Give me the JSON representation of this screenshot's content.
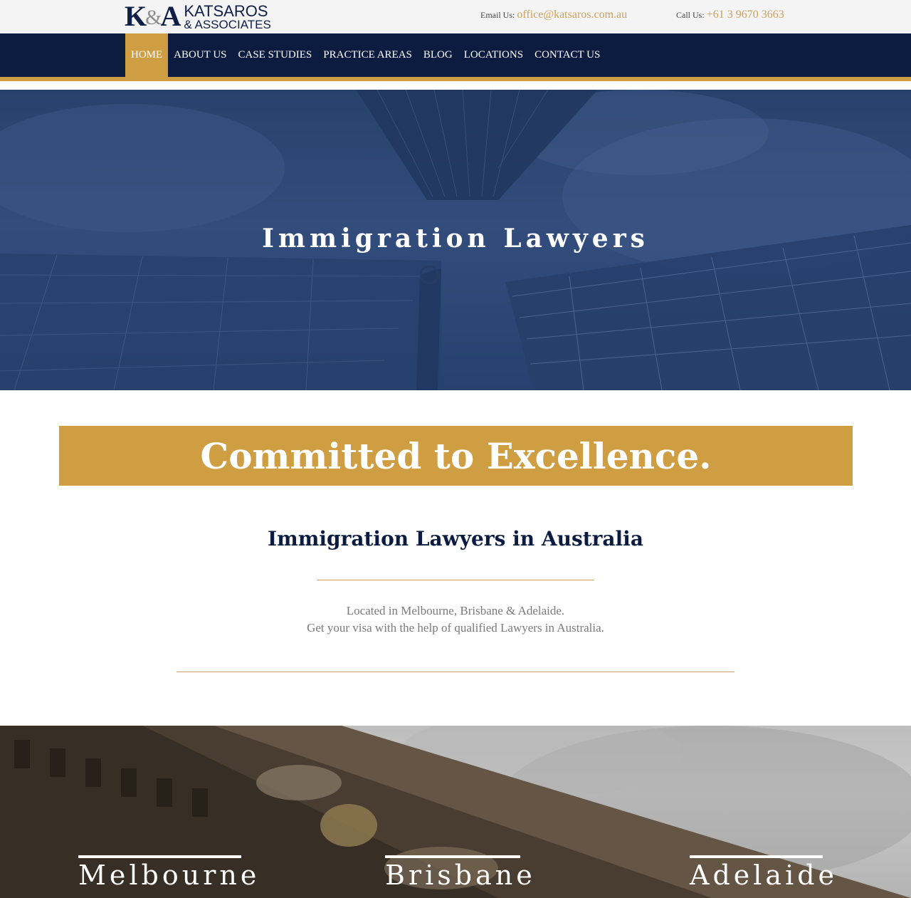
{
  "header": {
    "logo": {
      "mark": "K&A",
      "line1": "KATSAROS",
      "line2": "& ASSOCIATES"
    },
    "email_label": "Email Us:",
    "email_value": "office@katsaros.com.au",
    "phone_label": "Call Us:",
    "phone_value": "+61 3 9670 3663"
  },
  "nav": {
    "items": [
      {
        "label": "HOME",
        "active": true
      },
      {
        "label": "ABOUT US"
      },
      {
        "label": "CASE STUDIES"
      },
      {
        "label": "PRACTICE AREAS"
      },
      {
        "label": "BLOG"
      },
      {
        "label": "LOCATIONS"
      },
      {
        "label": "CONTACT US"
      }
    ]
  },
  "hero": {
    "title": "Immigration Lawyers"
  },
  "tagline": "Committed to Excellence.",
  "section": {
    "heading": "Immigration Lawyers in Australia",
    "line1": "Located in Melbourne, Brisbane & Adelaide.",
    "line2": "Get your visa with the help of qualified Lawyers in Australia."
  },
  "locations": [
    "Melbourne",
    "Brisbane",
    "Adelaide"
  ],
  "colors": {
    "navy": "#0c1c40",
    "gold": "#cf9e42",
    "link_gold": "#c9a160"
  }
}
